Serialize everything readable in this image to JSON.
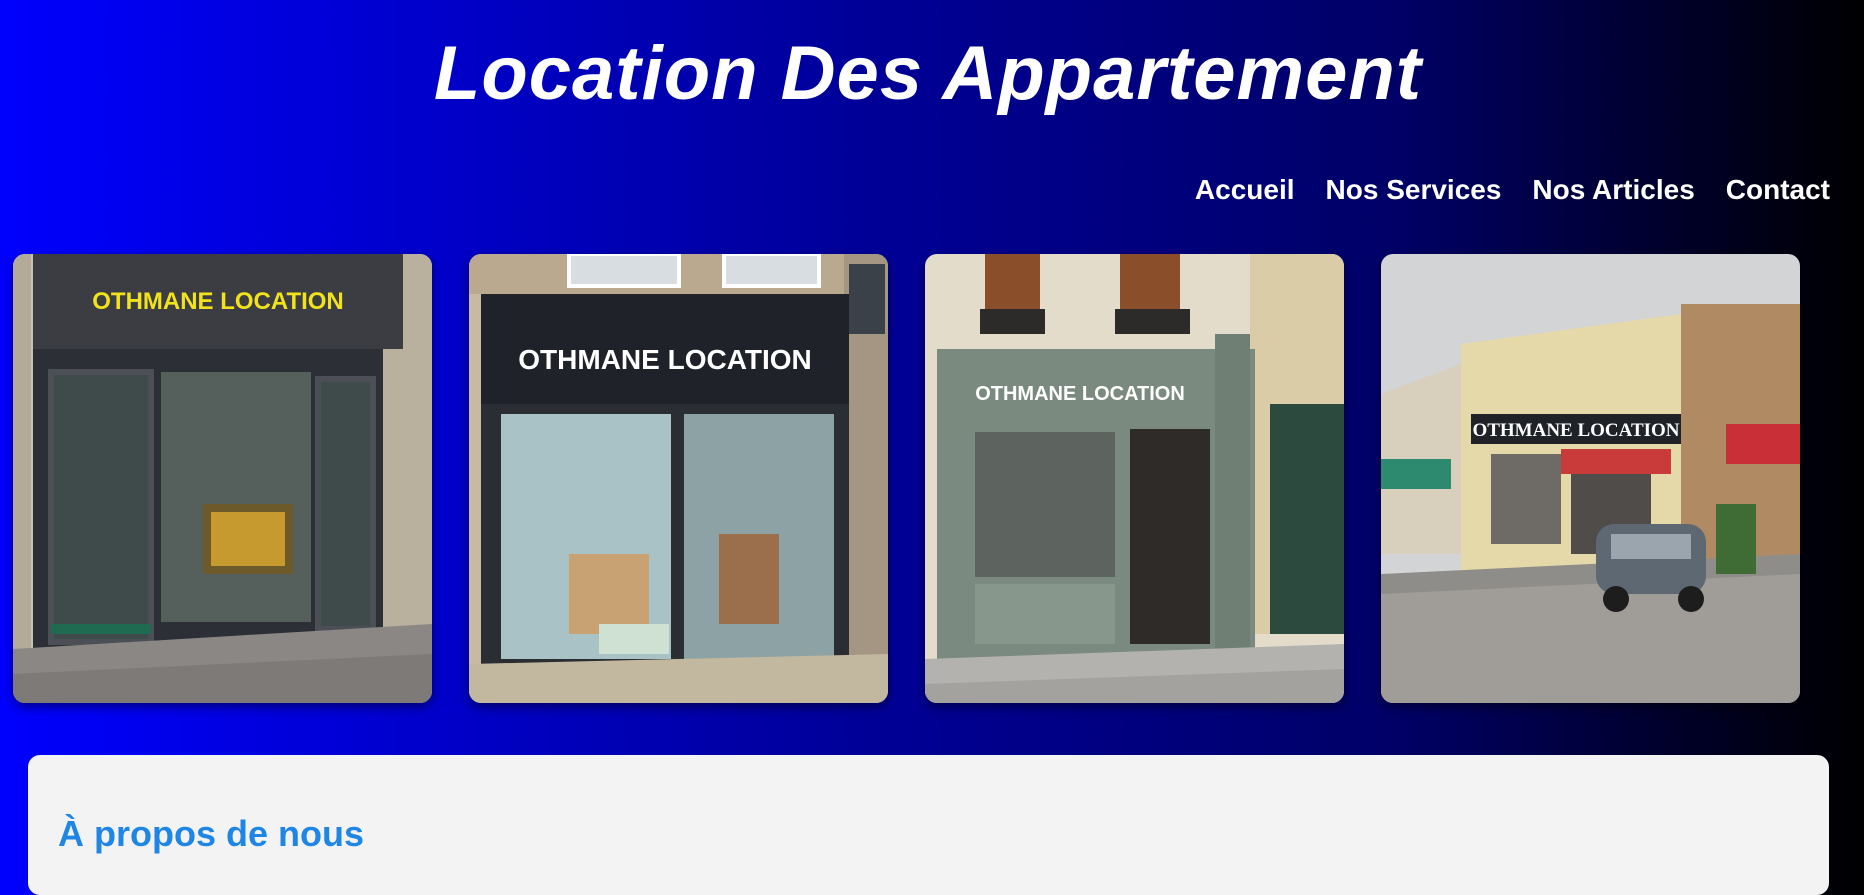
{
  "header": {
    "title": "Location Des Appartement"
  },
  "nav": {
    "items": [
      {
        "label": "Accueil"
      },
      {
        "label": "Nos Services"
      },
      {
        "label": "Nos Articles"
      },
      {
        "label": "Contact"
      }
    ]
  },
  "gallery": {
    "images": [
      {
        "sign": "OTHMANE LOCATION",
        "subject": "storefront-photo"
      },
      {
        "sign": "OTHMANE LOCATION",
        "subject": "storefront-photo"
      },
      {
        "sign": "OTHMANE LOCATION",
        "subject": "storefront-photo"
      },
      {
        "sign": "OTHMANE LOCATION",
        "subject": "storefront-photo"
      }
    ]
  },
  "about": {
    "heading": "À propos de nous"
  },
  "colors": {
    "background_start": "#0000fe",
    "background_end": "#000000",
    "accent": "#1f86e6",
    "panel": "#f3f3f3"
  }
}
